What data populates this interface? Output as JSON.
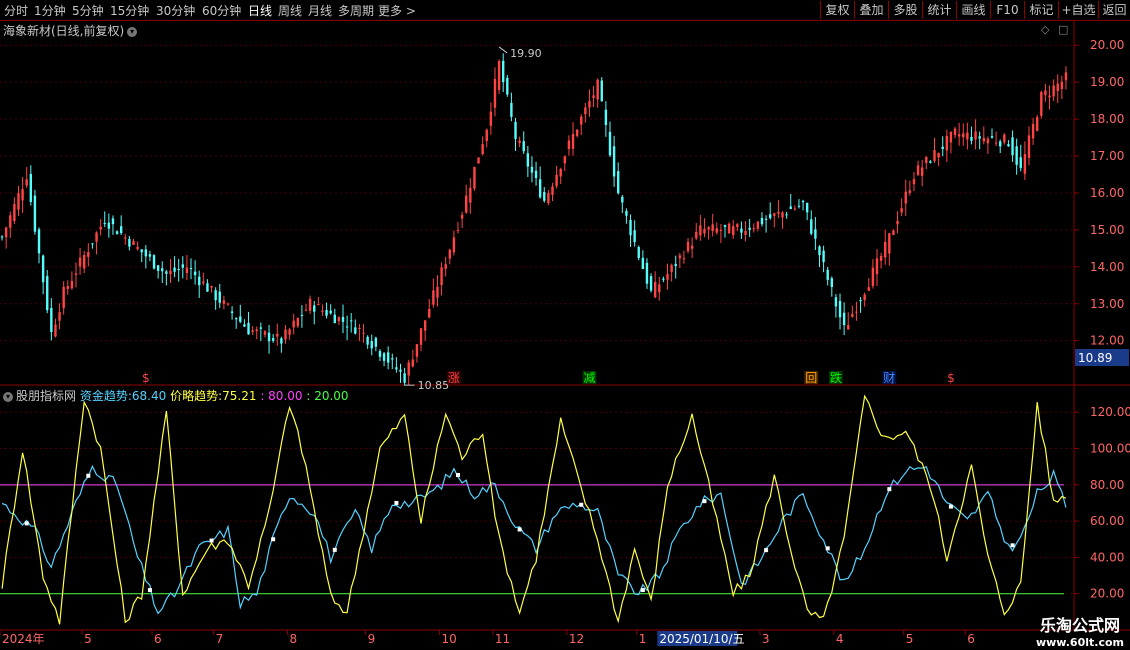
{
  "toolbar": {
    "periods": [
      "分时",
      "1分钟",
      "5分钟",
      "15分钟",
      "30分钟",
      "60分钟",
      "日线",
      "周线",
      "月线",
      "多周期",
      "更多 >"
    ],
    "active_period": "日线",
    "right_buttons": [
      "复权",
      "叠加",
      "多股",
      "统计",
      "画线",
      "F10",
      "标记",
      "+自选",
      "返回"
    ]
  },
  "stock": {
    "title": "海象新材(日线,前复权)"
  },
  "price_panel": {
    "ylim": [
      11.45,
      20.25
    ],
    "y_ticks": [
      "20.00",
      "19.00",
      "18.00",
      "17.00",
      "16.00",
      "15.00",
      "14.00",
      "13.00",
      "12.00"
    ],
    "current_price": "10.89",
    "high_label": "19.90",
    "low_label": "10.85",
    "up_color": "#ff4444",
    "down_color": "#54fcfc"
  },
  "markers": [
    {
      "x": 35,
      "text": "$",
      "color": "#ff4444"
    },
    {
      "x": 110,
      "text": "涨",
      "color": "#ff4444",
      "bg": "#330000"
    },
    {
      "x": 143,
      "text": "减",
      "color": "#00ff00",
      "bg": "#003300"
    },
    {
      "x": 197,
      "text": "回",
      "color": "#ffaa00",
      "bg": "#442200"
    },
    {
      "x": 203,
      "text": "跌",
      "color": "#00ff00",
      "bg": "#003300"
    },
    {
      "x": 216,
      "text": "财",
      "color": "#4488ff",
      "bg": "#001144"
    },
    {
      "x": 231,
      "text": "$",
      "color": "#ff4444"
    }
  ],
  "indicator": {
    "name": "股朋指标网",
    "s1_label": "资金趋势:",
    "s1_value": "68.40",
    "s1_color": "#54d2ff",
    "s2_label": "价略趋势:",
    "s2_value": "75.21",
    "s2_color": "#ffff44",
    "ref1": ": 80.00",
    "ref1_color": "#ff44ff",
    "ref2": ": 20.00",
    "ref2_color": "#44ff44",
    "ylim": [
      0,
      135
    ],
    "y_ticks": [
      "120.00",
      "100.00",
      "80.00",
      "60.00",
      "40.00",
      "20.00"
    ]
  },
  "chart_data": [
    {
      "type": "candlestick",
      "title": "海象新材(日线,前复权)",
      "n_bars": 260,
      "anchors": [
        [
          0,
          14.8
        ],
        [
          6,
          16.5
        ],
        [
          12,
          12.2
        ],
        [
          15,
          13.3
        ],
        [
          25,
          15.3
        ],
        [
          40,
          13.8
        ],
        [
          45,
          14.0
        ],
        [
          60,
          12.3
        ],
        [
          68,
          12.0
        ],
        [
          75,
          13.0
        ],
        [
          87,
          12.3
        ],
        [
          98,
          11.0
        ],
        [
          105,
          13.2
        ],
        [
          112,
          15.5
        ],
        [
          118,
          17.8
        ],
        [
          121,
          19.5
        ],
        [
          125,
          17.5
        ],
        [
          132,
          15.8
        ],
        [
          140,
          17.8
        ],
        [
          145,
          18.9
        ],
        [
          150,
          16.0
        ],
        [
          158,
          13.3
        ],
        [
          162,
          13.8
        ],
        [
          170,
          15.0
        ],
        [
          180,
          15.0
        ],
        [
          195,
          15.7
        ],
        [
          205,
          12.3
        ],
        [
          215,
          14.5
        ],
        [
          222,
          16.5
        ],
        [
          232,
          17.6
        ],
        [
          245,
          17.4
        ],
        [
          248,
          16.6
        ],
        [
          253,
          18.6
        ],
        [
          259,
          19.1
        ]
      ],
      "high": 19.9,
      "low": 10.85,
      "last": 10.89
    },
    {
      "type": "line",
      "ylim": [
        0,
        135
      ],
      "x_labels": [
        {
          "i": 0,
          "text": "2024年"
        },
        {
          "i": 20,
          "text": "5"
        },
        {
          "i": 37,
          "text": "6"
        },
        {
          "i": 52,
          "text": "7"
        },
        {
          "i": 70,
          "text": "8"
        },
        {
          "i": 89,
          "text": "9"
        },
        {
          "i": 107,
          "text": "10"
        },
        {
          "i": 120,
          "text": "11"
        },
        {
          "i": 138,
          "text": "12"
        },
        {
          "i": 155,
          "text": "1"
        },
        {
          "i": 161,
          "text": "2025/01/10/五"
        },
        {
          "i": 185,
          "text": "3"
        },
        {
          "i": 203,
          "text": "4"
        },
        {
          "i": 220,
          "text": "5"
        },
        {
          "i": 235,
          "text": "6"
        }
      ],
      "series": [
        {
          "name": "资金趋势",
          "color": "#54d2ff",
          "anchors": [
            [
              0,
              70
            ],
            [
              8,
              55
            ],
            [
              12,
              35
            ],
            [
              18,
              70
            ],
            [
              22,
              90
            ],
            [
              28,
              80
            ],
            [
              33,
              40
            ],
            [
              38,
              10
            ],
            [
              42,
              20
            ],
            [
              48,
              45
            ],
            [
              55,
              55
            ],
            [
              58,
              15
            ],
            [
              62,
              20
            ],
            [
              66,
              50
            ],
            [
              70,
              75
            ],
            [
              76,
              65
            ],
            [
              80,
              40
            ],
            [
              86,
              65
            ],
            [
              90,
              45
            ],
            [
              95,
              70
            ],
            [
              100,
              70
            ],
            [
              106,
              78
            ],
            [
              110,
              88
            ],
            [
              115,
              75
            ],
            [
              120,
              80
            ],
            [
              125,
              58
            ],
            [
              130,
              45
            ],
            [
              135,
              65
            ],
            [
              140,
              70
            ],
            [
              145,
              65
            ],
            [
              150,
              30
            ],
            [
              155,
              20
            ],
            [
              160,
              30
            ],
            [
              165,
              55
            ],
            [
              170,
              70
            ],
            [
              175,
              75
            ],
            [
              180,
              25
            ],
            [
              185,
              40
            ],
            [
              190,
              60
            ],
            [
              195,
              75
            ],
            [
              200,
              50
            ],
            [
              205,
              25
            ],
            [
              210,
              45
            ],
            [
              215,
              75
            ],
            [
              220,
              88
            ],
            [
              225,
              90
            ],
            [
              230,
              70
            ],
            [
              235,
              60
            ],
            [
              240,
              75
            ],
            [
              245,
              45
            ],
            [
              248,
              50
            ],
            [
              252,
              75
            ],
            [
              256,
              85
            ],
            [
              259,
              68.4
            ]
          ]
        },
        {
          "name": "价略趋势",
          "color": "#ffff44",
          "anchors": [
            [
              0,
              25
            ],
            [
              5,
              100
            ],
            [
              10,
              30
            ],
            [
              14,
              5
            ],
            [
              20,
              128
            ],
            [
              24,
              100
            ],
            [
              30,
              5
            ],
            [
              34,
              20
            ],
            [
              40,
              120
            ],
            [
              44,
              20
            ],
            [
              50,
              45
            ],
            [
              55,
              50
            ],
            [
              60,
              25
            ],
            [
              65,
              65
            ],
            [
              70,
              125
            ],
            [
              74,
              90
            ],
            [
              80,
              18
            ],
            [
              84,
              10
            ],
            [
              88,
              55
            ],
            [
              92,
              100
            ],
            [
              98,
              118
            ],
            [
              102,
              60
            ],
            [
              108,
              120
            ],
            [
              112,
              95
            ],
            [
              117,
              110
            ],
            [
              121,
              50
            ],
            [
              126,
              10
            ],
            [
              130,
              40
            ],
            [
              136,
              115
            ],
            [
              140,
              85
            ],
            [
              145,
              50
            ],
            [
              150,
              5
            ],
            [
              154,
              45
            ],
            [
              158,
              15
            ],
            [
              162,
              80
            ],
            [
              168,
              118
            ],
            [
              172,
              80
            ],
            [
              178,
              20
            ],
            [
              182,
              30
            ],
            [
              188,
              85
            ],
            [
              192,
              45
            ],
            [
              196,
              10
            ],
            [
              200,
              5
            ],
            [
              205,
              50
            ],
            [
              210,
              128
            ],
            [
              215,
              105
            ],
            [
              220,
              110
            ],
            [
              226,
              80
            ],
            [
              230,
              40
            ],
            [
              236,
              90
            ],
            [
              240,
              40
            ],
            [
              244,
              10
            ],
            [
              248,
              25
            ],
            [
              252,
              125
            ],
            [
              256,
              70
            ],
            [
              259,
              75.21
            ]
          ]
        }
      ],
      "reference_lines": [
        80,
        20
      ]
    }
  ],
  "watermark": {
    "line1": "乐淘公式网",
    "line2": "www.60lt.com"
  }
}
